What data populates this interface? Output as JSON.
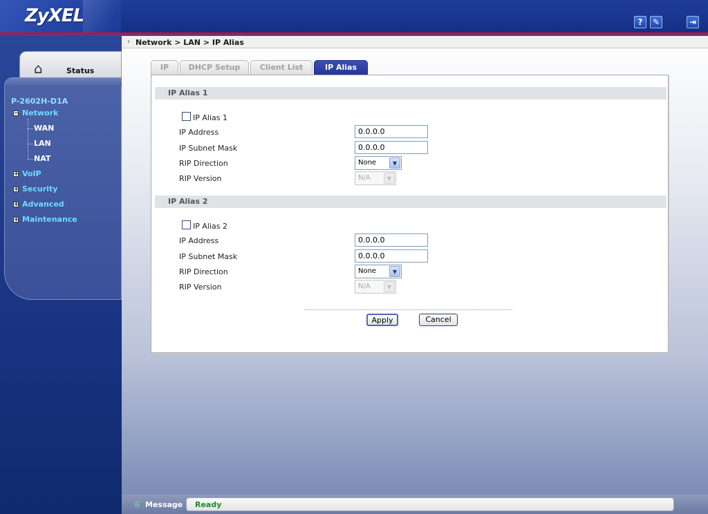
{
  "header": {
    "logo": "ZyXEL",
    "icons": [
      "help-icon",
      "wizard-icon",
      "logout-icon"
    ],
    "help_glyph": "?",
    "wizard_glyph": "✎",
    "logout_glyph": "⇥"
  },
  "sidebar": {
    "status_label": "Status",
    "device": "P-2602H-D1A",
    "items": [
      {
        "label": "Network",
        "expanded": true,
        "children": [
          "WAN",
          "LAN",
          "NAT"
        ]
      },
      {
        "label": "VoIP",
        "expanded": false
      },
      {
        "label": "Security",
        "expanded": false
      },
      {
        "label": "Advanced",
        "expanded": false
      },
      {
        "label": "Maintenance",
        "expanded": false
      }
    ]
  },
  "breadcrumb": "Network > LAN > IP Alias",
  "tabs": [
    "IP",
    "DHCP Setup",
    "Client List",
    "IP Alias"
  ],
  "active_tab": "IP Alias",
  "alias1": {
    "section_title": "IP Alias 1",
    "checkbox_label": "IP Alias 1",
    "checked": false,
    "ip_label": "IP Address",
    "ip_value": "0.0.0.0",
    "mask_label": "IP Subnet Mask",
    "mask_value": "0.0.0.0",
    "rip_dir_label": "RIP Direction",
    "rip_dir_value": "None",
    "rip_ver_label": "RIP Version",
    "rip_ver_value": "N/A"
  },
  "alias2": {
    "section_title": "IP Alias 2",
    "checkbox_label": "IP Alias 2",
    "checked": false,
    "ip_label": "IP Address",
    "ip_value": "0.0.0.0",
    "mask_label": "IP Subnet Mask",
    "mask_value": "0.0.0.0",
    "rip_dir_label": "RIP Direction",
    "rip_dir_value": "None",
    "rip_ver_label": "RIP Version",
    "rip_ver_value": "N/A"
  },
  "buttons": {
    "apply": "Apply",
    "cancel": "Cancel"
  },
  "message": {
    "label": "Message",
    "text": "Ready"
  },
  "colors": {
    "accent": "#24349a",
    "header": "#18348e",
    "header_stripe": "#c8102e",
    "status_ok": "#1f8a2c"
  }
}
